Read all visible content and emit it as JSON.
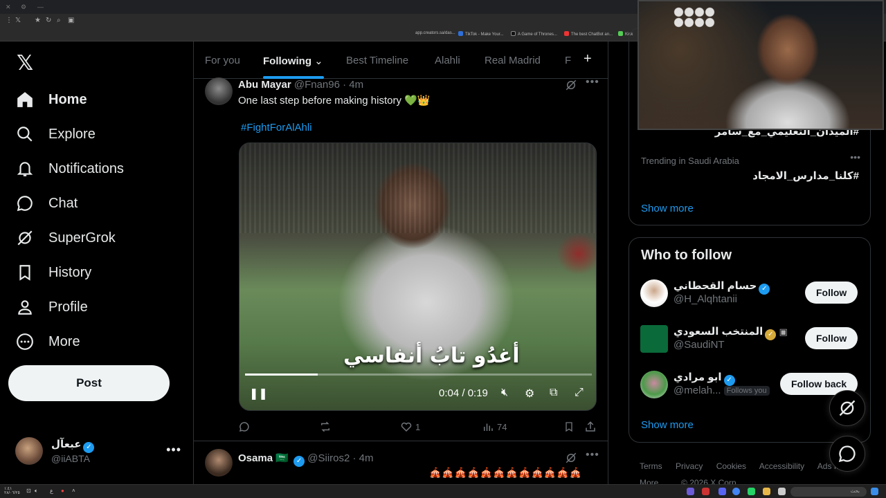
{
  "browser": {
    "bookmarks": [
      "app.creators.sa/das...",
      "TikTok - Make Your...",
      "A Game of Thrones...",
      "The best ChatBot an...",
      "Kick"
    ]
  },
  "nav": {
    "items": [
      {
        "label": "Home",
        "icon": "home-icon"
      },
      {
        "label": "Explore",
        "icon": "search-icon"
      },
      {
        "label": "Notifications",
        "icon": "bell-icon"
      },
      {
        "label": "Chat",
        "icon": "chat-icon"
      },
      {
        "label": "SuperGrok",
        "icon": "grok-icon"
      },
      {
        "label": "History",
        "icon": "bookmark-icon"
      },
      {
        "label": "Profile",
        "icon": "person-icon"
      },
      {
        "label": "More",
        "icon": "more-circle-icon"
      }
    ],
    "post_label": "Post"
  },
  "account": {
    "display_name": "عبعآل",
    "handle": "@iiABTA"
  },
  "tabs": {
    "items": [
      "For you",
      "Following",
      "Best Timeline",
      "Alahli",
      "Real Madrid",
      "F"
    ],
    "active": "Following"
  },
  "tweet1": {
    "name": "Abu Mayar",
    "handle": "@Fnan96",
    "time": "· 4m",
    "text": "One last step before making history 💚👑",
    "hashtag": "#FightForAlAhli",
    "video": {
      "overlay_text": "أغدُو تابُ أنفاسي",
      "time": "0:04 / 0:19",
      "progress": 0.21
    },
    "stats": {
      "likes": "1",
      "views": "74"
    }
  },
  "tweet2": {
    "name": "Osama",
    "flag": "🇸🇦",
    "handle": "@Siiros2",
    "time": "· 4m",
    "text_preview": "🎪🎪🎪🎪🎪🎪🎪🎪🎪🎪🎪🎪"
  },
  "trends": {
    "top_trend": "#الميدان_التعليمي_مع_سامر",
    "items": [
      {
        "context": "Trending in Saudi Arabia",
        "title": "#كلنا_مدارس_الامجاد"
      }
    ],
    "show_more": "Show more"
  },
  "who_to_follow": {
    "title": "Who to follow",
    "items": [
      {
        "name": "حسام القحطاني",
        "handle": "@H_Alqhtanii",
        "button": "Follow",
        "badge": "blue"
      },
      {
        "name": "المنتخب السعودي",
        "handle": "@SaudiNT",
        "button": "Follow",
        "badge": "gold"
      },
      {
        "name": "ابو مرادي",
        "handle": "@melah...",
        "follows_you": "Follows you",
        "button": "Follow back",
        "badge": "blue"
      }
    ],
    "show_more": "Show more"
  },
  "footer": {
    "links": [
      "Terms",
      "Privacy",
      "Cookies",
      "Accessibility",
      "Ads Info",
      "More ...",
      "© 2026 X Corp."
    ]
  },
  "taskbar": {
    "clock": "١:٤١",
    "date": "٢٨/٠٦/٢٥",
    "lang": "ع",
    "search_placeholder": "بحث"
  },
  "colors": {
    "accent": "#1d9bf0",
    "background": "#000000",
    "border": "#2f3336",
    "muted": "#71767b"
  }
}
